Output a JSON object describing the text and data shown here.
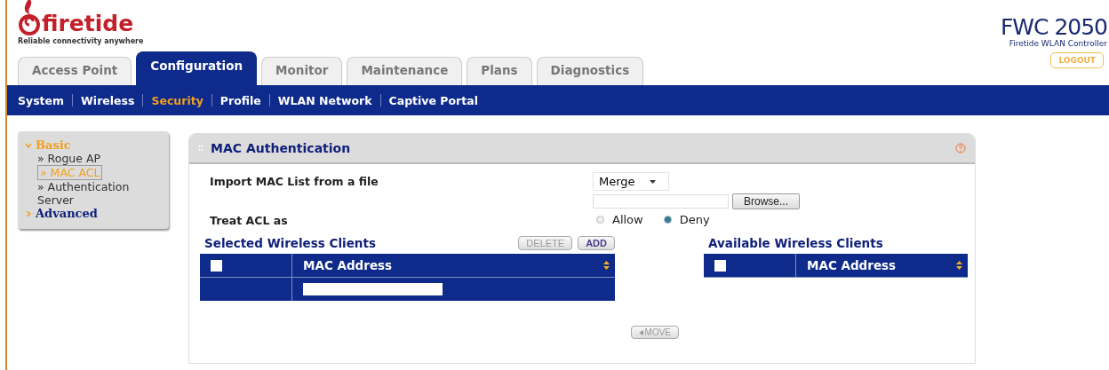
{
  "logo": {
    "name": "firetide",
    "tagline": "Reliable connectivity anywhere"
  },
  "product": {
    "model": "FWC 2050",
    "subtitle": "Firetide WLAN Controller",
    "logout": "LOGOUT"
  },
  "tabs": [
    {
      "label": "Access Point",
      "selected": false
    },
    {
      "label": "Configuration",
      "selected": true
    },
    {
      "label": "Monitor",
      "selected": false
    },
    {
      "label": "Maintenance",
      "selected": false
    },
    {
      "label": "Plans",
      "selected": false
    },
    {
      "label": "Diagnostics",
      "selected": false
    }
  ],
  "subnav": [
    {
      "label": "System",
      "selected": false
    },
    {
      "label": "Wireless",
      "selected": false
    },
    {
      "label": "Security",
      "selected": true
    },
    {
      "label": "Profile",
      "selected": false
    },
    {
      "label": "WLAN Network",
      "selected": false
    },
    {
      "label": "Captive Portal",
      "selected": false
    }
  ],
  "sidebar": {
    "groups": [
      {
        "label": "Basic",
        "expanded": true,
        "children": [
          {
            "label": "» Rogue AP",
            "selected": false
          },
          {
            "label": "» MAC ACL",
            "selected": true
          },
          {
            "label": "» Authentication Server",
            "selected": false
          }
        ]
      },
      {
        "label": "Advanced",
        "expanded": false
      }
    ]
  },
  "panel": {
    "title": "MAC Authentication",
    "import_label": "Import MAC List from a file",
    "mode": "Merge",
    "browse": "Browse...",
    "treat_label": "Treat ACL as",
    "radios": [
      {
        "label": "Allow",
        "selected": false
      },
      {
        "label": "Deny",
        "selected": true
      }
    ],
    "selected_clients": {
      "title": "Selected Wireless Clients",
      "buttons": [
        {
          "label": "DELETE",
          "disabled": true
        },
        {
          "label": "ADD",
          "disabled": false
        }
      ],
      "column": "MAC Address",
      "all_checked": false
    },
    "available_clients": {
      "title": "Available Wireless Clients",
      "column": "MAC Address",
      "all_checked": false
    },
    "move": {
      "label": "MOVE",
      "disabled": true
    }
  }
}
